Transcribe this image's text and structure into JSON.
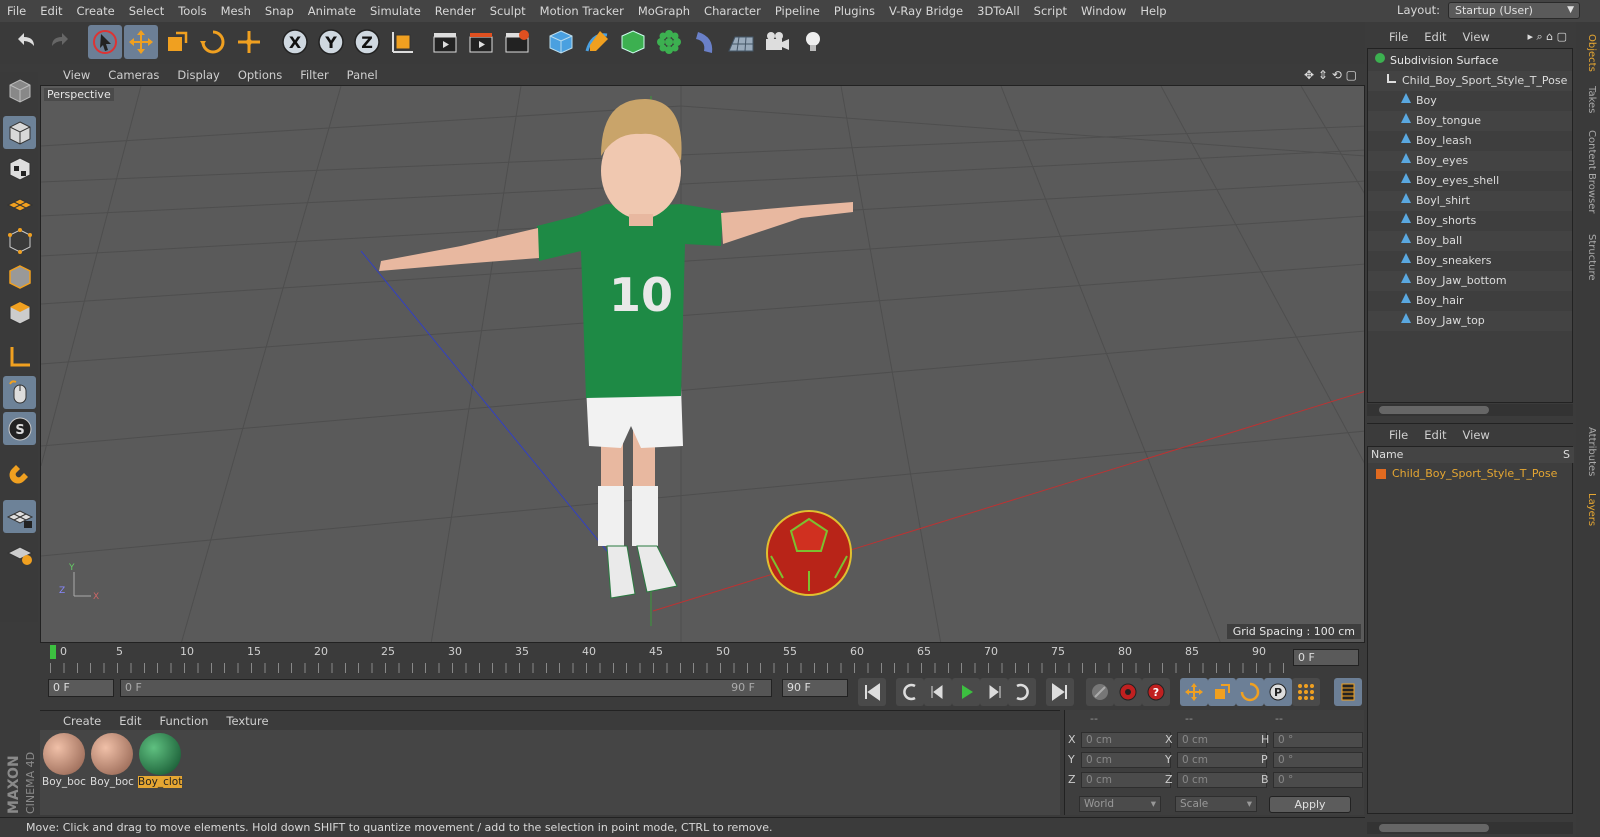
{
  "menubar": {
    "items": [
      "File",
      "Edit",
      "Create",
      "Select",
      "Tools",
      "Mesh",
      "Snap",
      "Animate",
      "Simulate",
      "Render",
      "Sculpt",
      "Motion Tracker",
      "MoGraph",
      "Character",
      "Pipeline",
      "Plugins",
      "V-Ray Bridge",
      "3DToAll",
      "Script",
      "Window",
      "Help"
    ],
    "layout_label": "Layout:",
    "layout_value": "Startup (User)"
  },
  "viewport": {
    "menu": [
      "View",
      "Cameras",
      "Display",
      "Options",
      "Filter",
      "Panel"
    ],
    "label": "Perspective",
    "grid_spacing": "Grid Spacing : 100 cm"
  },
  "timeline": {
    "ticks": [
      "0",
      "5",
      "10",
      "15",
      "20",
      "25",
      "30",
      "35",
      "40",
      "45",
      "50",
      "55",
      "60",
      "65",
      "70",
      "75",
      "80",
      "85",
      "90"
    ],
    "current_frame": "0 F"
  },
  "transport": {
    "start_field": "0 F",
    "slider_start": "0 F",
    "slider_end": "90 F",
    "end_field": "90 F"
  },
  "materials": {
    "menu": [
      "Create",
      "Edit",
      "Function",
      "Texture"
    ],
    "items": [
      {
        "label": "Boy_boc"
      },
      {
        "label": "Boy_boc"
      },
      {
        "label": "Boy_clot"
      }
    ]
  },
  "coords": {
    "header": [
      "--",
      "--",
      "--"
    ],
    "pos_x": "0 cm",
    "pos_y": "0 cm",
    "pos_z": "0 cm",
    "size_x": "0 cm",
    "size_y": "0 cm",
    "size_z": "0 cm",
    "rot_h": "0 °",
    "rot_p": "0 °",
    "rot_b": "0 °",
    "labels": {
      "x": "X",
      "y": "Y",
      "z": "Z",
      "h": "H",
      "p": "P",
      "b": "B"
    },
    "world_select": "World",
    "scale_select": "Scale",
    "apply": "Apply"
  },
  "status": "Move: Click and drag to move elements. Hold down SHIFT to quantize movement / add to the selection in point mode, CTRL to remove.",
  "objects_panel": {
    "menu": [
      "File",
      "Edit",
      "View"
    ],
    "root": "Subdivision Surface",
    "group": "Child_Boy_Sport_Style_T_Pose",
    "children": [
      "Boy",
      "Boy_tongue",
      "Boy_leash",
      "Boy_eyes",
      "Boy_eyes_shell",
      "Boyl_shirt",
      "Boy_shorts",
      "Boy_ball",
      "Boy_sneakers",
      "Boy_Jaw_bottom",
      "Boy_hair",
      "Boy_Jaw_top"
    ]
  },
  "layers_panel": {
    "menu": [
      "File",
      "Edit",
      "View"
    ],
    "col_name": "Name",
    "col_s": "S",
    "row": "Child_Boy_Sport_Style_T_Pose"
  },
  "vtabs": [
    "Objects",
    "Takes",
    "Content Browser",
    "Structure",
    "Attributes",
    "Layers"
  ],
  "brand": {
    "top": "MAXON",
    "bottom": "CINEMA 4D"
  },
  "colors": {
    "accent": "#e5a632",
    "selected_tool": "#6c7f96",
    "viewport_bg": "#5a5a5a"
  }
}
